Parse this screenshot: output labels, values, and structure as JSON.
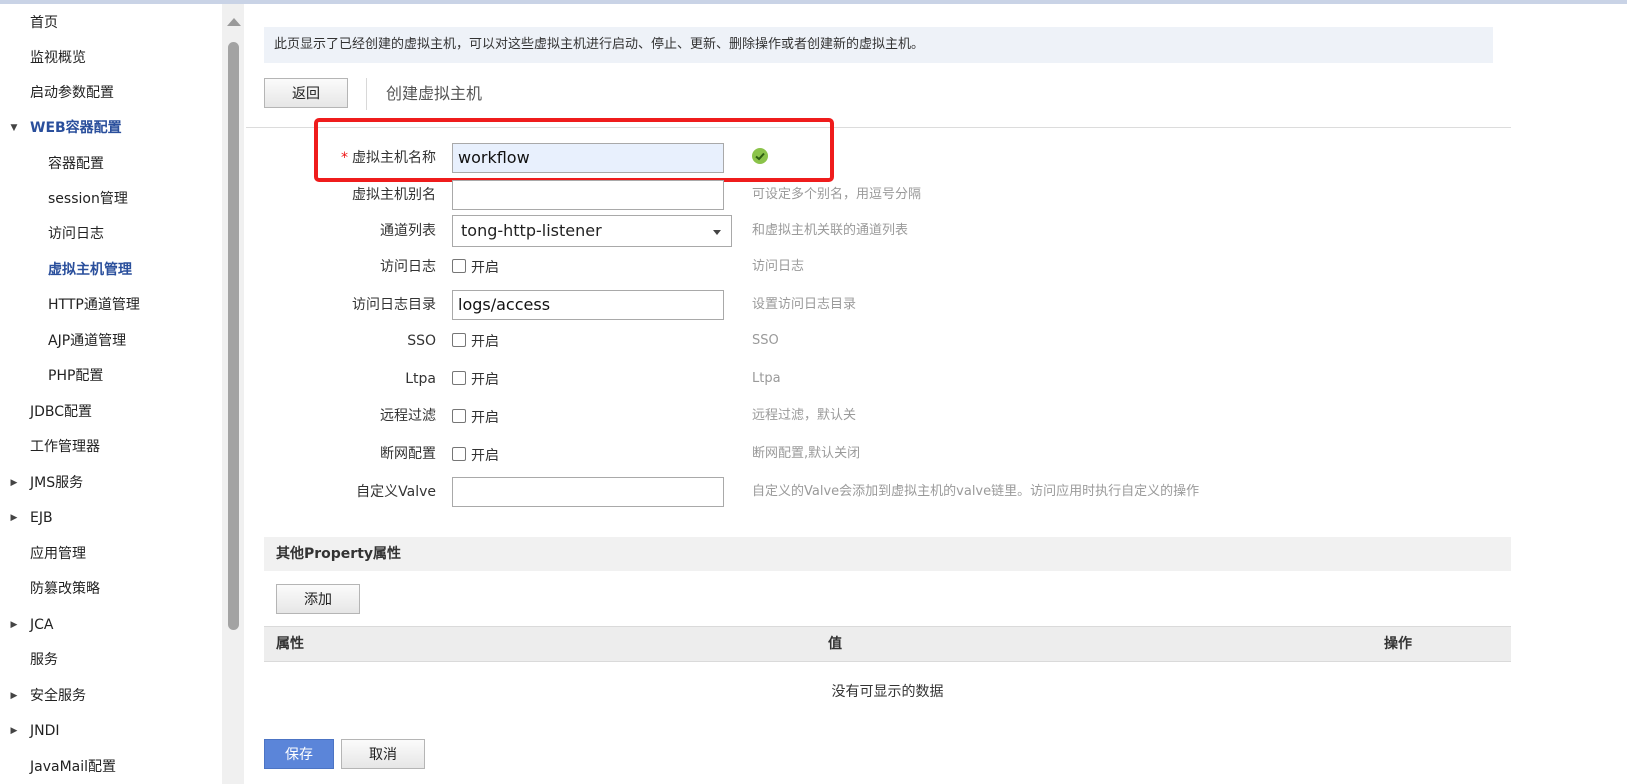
{
  "sidebar": {
    "items": [
      {
        "label": "首页",
        "level": 1,
        "arrow": ""
      },
      {
        "label": "监视概览",
        "level": 1,
        "arrow": ""
      },
      {
        "label": "启动参数配置",
        "level": 1,
        "arrow": ""
      },
      {
        "label": "WEB容器配置",
        "level": 1,
        "arrow": "▼"
      },
      {
        "label": "容器配置",
        "level": 2,
        "arrow": ""
      },
      {
        "label": "session管理",
        "level": 2,
        "arrow": ""
      },
      {
        "label": "访问日志",
        "level": 2,
        "arrow": ""
      },
      {
        "label": "虚拟主机管理",
        "level": 2,
        "arrow": ""
      },
      {
        "label": "HTTP通道管理",
        "level": 2,
        "arrow": ""
      },
      {
        "label": "AJP通道管理",
        "level": 2,
        "arrow": ""
      },
      {
        "label": "PHP配置",
        "level": 2,
        "arrow": ""
      },
      {
        "label": "JDBC配置",
        "level": 1,
        "arrow": ""
      },
      {
        "label": "工作管理器",
        "level": 1,
        "arrow": ""
      },
      {
        "label": "JMS服务",
        "level": 1,
        "arrow": "▶"
      },
      {
        "label": "EJB",
        "level": 1,
        "arrow": "▶"
      },
      {
        "label": "应用管理",
        "level": 1,
        "arrow": ""
      },
      {
        "label": "防篡改策略",
        "level": 1,
        "arrow": ""
      },
      {
        "label": "JCA",
        "level": 1,
        "arrow": "▶"
      },
      {
        "label": "服务",
        "level": 1,
        "arrow": ""
      },
      {
        "label": "安全服务",
        "level": 1,
        "arrow": "▶"
      },
      {
        "label": "JNDI",
        "level": 1,
        "arrow": "▶"
      },
      {
        "label": "JavaMail配置",
        "level": 1,
        "arrow": ""
      }
    ]
  },
  "main": {
    "description": "此页显示了已经创建的虚拟主机，可以对这些虚拟主机进行启动、停止、更新、删除操作或者创建新的虚拟主机。",
    "back_label": "返回",
    "subtitle": "创建虚拟主机"
  },
  "form": {
    "required_mark": "*",
    "name": {
      "label": "虚拟主机名称",
      "value": "workflow"
    },
    "alias": {
      "label": "虚拟主机别名",
      "value": "",
      "hint": "可设定多个别名，用逗号分隔"
    },
    "channel": {
      "label": "通道列表",
      "value": "tong-http-listener",
      "hint": "和虚拟主机关联的通道列表"
    },
    "access_log": {
      "label": "访问日志",
      "check_label": "开启",
      "hint": "访问日志"
    },
    "access_log_dir": {
      "label": "访问日志目录",
      "value": "logs/access",
      "hint": "设置访问日志目录"
    },
    "sso": {
      "label": "SSO",
      "check_label": "开启",
      "hint": "SSO"
    },
    "ltpa": {
      "label": "Ltpa",
      "check_label": "开启",
      "hint": "Ltpa"
    },
    "remote_filter": {
      "label": "远程过滤",
      "check_label": "开启",
      "hint": "远程过滤，默认关"
    },
    "network_break": {
      "label": "断网配置",
      "check_label": "开启",
      "hint": "断网配置,默认关闭"
    },
    "valve": {
      "label": "自定义Valve",
      "value": "",
      "hint": "自定义的Valve会添加到虚拟主机的valve链里。访问应用时执行自定义的操作"
    }
  },
  "property": {
    "section_title": "其他Property属性",
    "add_label": "添加",
    "columns": [
      "属性",
      "值",
      "操作"
    ],
    "empty_text": "没有可显示的数据"
  },
  "actions": {
    "save_label": "保存",
    "cancel_label": "取消"
  },
  "colors": {
    "accent": "#5b85d9",
    "highlight": "#ef1c1c",
    "nav_active": "#2a4f9c",
    "valid": "#8bc34a"
  }
}
